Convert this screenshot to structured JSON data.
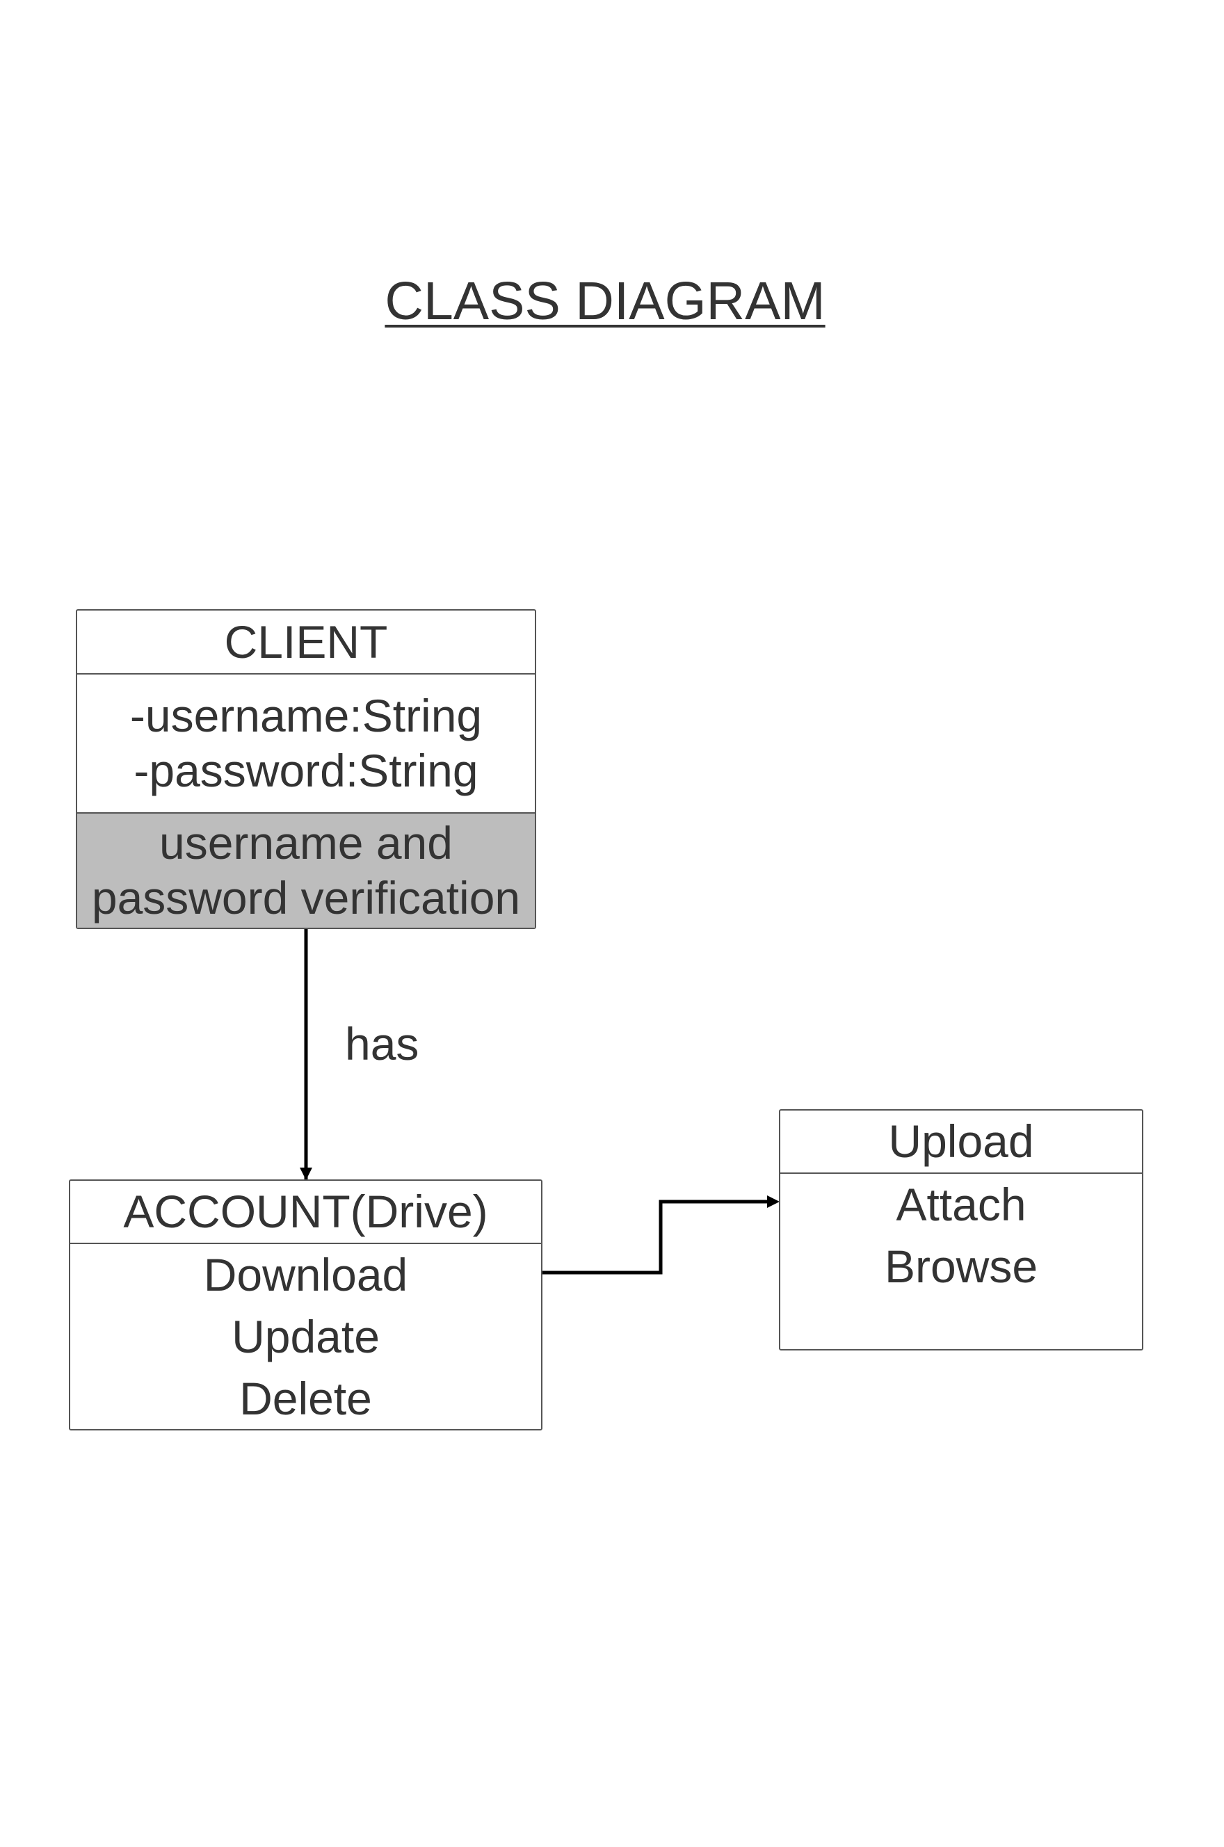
{
  "title": "CLASS DIAGRAM",
  "classes": {
    "client": {
      "name": "CLIENT",
      "attributes": [
        "-username:String",
        "-password:String"
      ],
      "operations": [
        "username and",
        "password verification"
      ]
    },
    "account": {
      "name": "ACCOUNT(Drive)",
      "operations": [
        "Download",
        "Update",
        "Delete"
      ]
    },
    "upload": {
      "name": "Upload",
      "operations": [
        "Attach",
        "Browse"
      ]
    }
  },
  "relationships": {
    "client_account_label": "has"
  },
  "colors": {
    "text": "#333333",
    "border": "#555555",
    "connector": "#000000",
    "shaded_section": "#bdbdbd",
    "background": "#ffffff"
  }
}
